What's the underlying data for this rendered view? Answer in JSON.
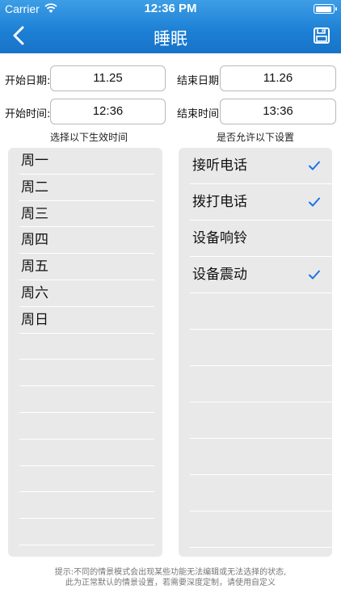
{
  "status_bar": {
    "carrier": "Carrier",
    "time": "12:36 PM",
    "battery_level": 0.95
  },
  "nav": {
    "title": "睡眠",
    "back_icon": "chevron-left-icon",
    "save_icon": "floppy-disk-icon"
  },
  "dates": {
    "start_date_label": "开始日期:",
    "start_date_value": "11.25",
    "end_date_label": "结束日期:",
    "end_date_value": "11.26",
    "start_time_label": "开始时间:",
    "start_time_value": "12:36",
    "end_time_label": "结束时间:",
    "end_time_value": "13:36"
  },
  "days_section": {
    "caption": "选择以下生效时间",
    "items": [
      "周一",
      "周二",
      "周三",
      "周四",
      "周五",
      "周六",
      "周日"
    ]
  },
  "options_section": {
    "caption": "是否允许以下设置",
    "items": [
      {
        "label": "接听电话",
        "checked": true
      },
      {
        "label": "拨打电话",
        "checked": true
      },
      {
        "label": "设备响铃",
        "checked": false
      },
      {
        "label": "设备震动",
        "checked": true
      }
    ]
  },
  "footer": {
    "line1": "提示:不同的情景模式会出现某些功能无法编辑或无法选择的状态,",
    "line2": "此为正常默认的情景设置，若需要深度定制，请使用自定义"
  },
  "colors": {
    "accent": "#1c7fd4",
    "check": "#1a73e8",
    "panel": "#e9e9e9"
  }
}
